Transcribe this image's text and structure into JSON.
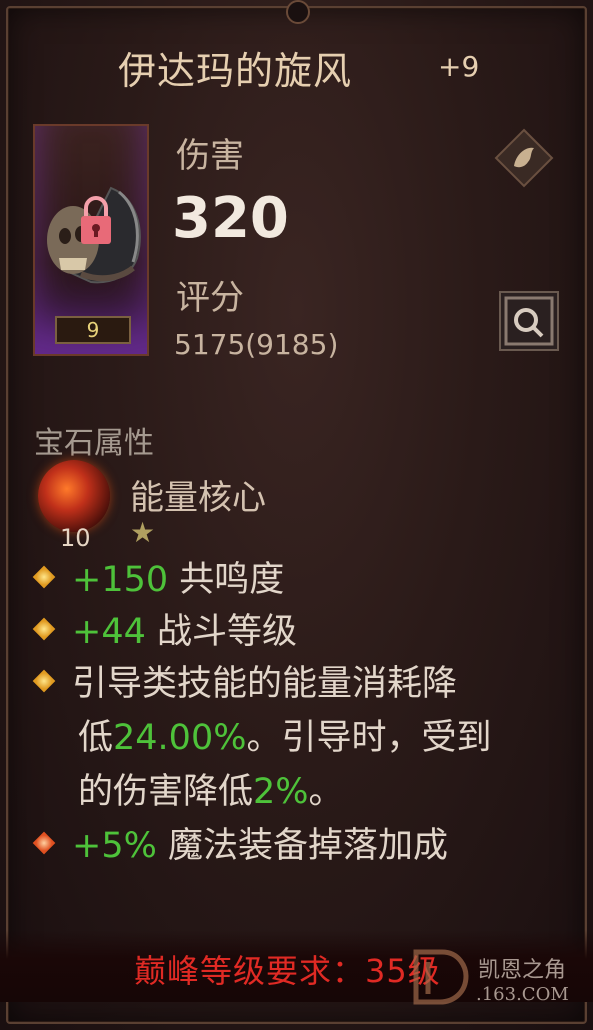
{
  "item": {
    "name": "伊达玛的旋风",
    "upgrade": "+9",
    "item_level": "9",
    "locked": true
  },
  "stats": {
    "damage_label": "伤害",
    "damage_value": "320",
    "score_label": "评分",
    "score_value": "5175(9185)"
  },
  "gem_section": {
    "title": "宝石属性",
    "gem_name": "能量核心",
    "gem_level": "10",
    "gem_rating_icon": "star"
  },
  "affixes": [
    {
      "value": "+150",
      "text": " 共鸣度"
    },
    {
      "value": "+44",
      "text": " 战斗等级"
    },
    {
      "line1": "引导类技能的能量消耗降",
      "line2_prefix": "低",
      "line2_value": "24.00%",
      "line2_suffix": "。引导时，受到",
      "line3_prefix": "的伤害降低",
      "line3_value": "2%",
      "line3_suffix": "。"
    },
    {
      "value": "+5%",
      "text": " 魔法装备掉落加成"
    }
  ],
  "footer": {
    "requirement": "巅峰等级要求：35级"
  },
  "watermark": {
    "site_name": "凯恩之角",
    "url": ".163.COM"
  },
  "colors": {
    "green": "#4ec23a",
    "requirement_red": "#e02a24",
    "title": "#e6cfb0"
  }
}
